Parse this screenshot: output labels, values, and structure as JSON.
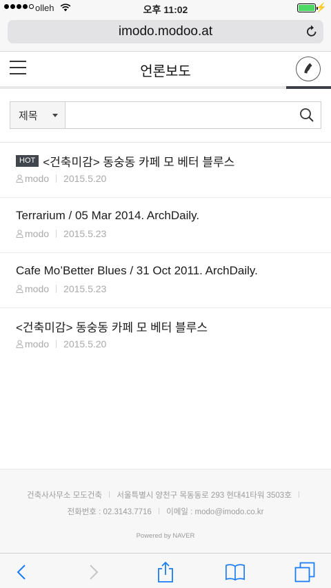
{
  "status": {
    "carrier": "olleh",
    "time": "오후 11:02",
    "charge_symbol": "⚡"
  },
  "browser": {
    "url": "imodo.modoo.at"
  },
  "header": {
    "title": "언론보도"
  },
  "search": {
    "field_label": "제목",
    "placeholder": ""
  },
  "articles": [
    {
      "badge": "HOT",
      "title": "<건축미감> 동숭동 카페 모 베터 블루스",
      "author": "modo",
      "date": "2015.5.20"
    },
    {
      "badge": "",
      "title": "Terrarium / 05 Mar 2014. ArchDaily.",
      "author": "modo",
      "date": "2015.5.23"
    },
    {
      "badge": "",
      "title": "Cafe Mo’Better Blues / 31 Oct 2011. ArchDaily.",
      "author": "modo",
      "date": "2015.5.23"
    },
    {
      "badge": "",
      "title": "<건축미감> 동숭동 카페 모 베터 블루스",
      "author": "modo",
      "date": "2015.5.20"
    }
  ],
  "footer": {
    "company": "건축사사무소 모도건축",
    "address": "서울특별시 양천구 목동동로 293 현대41타워 3503호",
    "phone": "전화번호 : 02.3143.7716",
    "email": "이메일 : modo@imodo.co.kr",
    "powered": "Powered by NAVER"
  },
  "colors": {
    "accent_dark": "#3c4149",
    "ios_blue": "#1a7cf5",
    "battery_green": "#4cd964"
  }
}
